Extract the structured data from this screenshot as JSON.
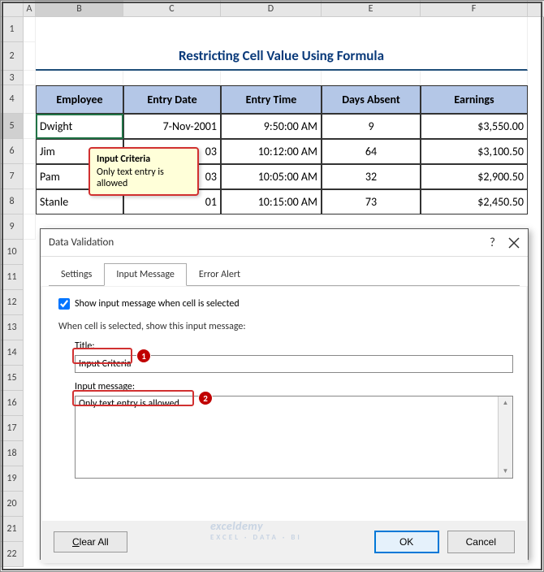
{
  "columns": [
    "A",
    "B",
    "C",
    "D",
    "E",
    "F"
  ],
  "title": "Restricting Cell Value Using Formula",
  "headers": {
    "b": "Employee",
    "c": "Entry Date",
    "d": "Entry Time",
    "e": "Days Absent",
    "f": "Earnings"
  },
  "rows": [
    {
      "b": "Dwight",
      "c": "7-Nov-2001",
      "d": "9:50:00 AM",
      "e": "9",
      "f": "$3,550.00"
    },
    {
      "b": "Jim",
      "c": "03",
      "d": "10:12:00 AM",
      "e": "64",
      "f": "$3,100.50"
    },
    {
      "b": "Pam",
      "c": "03",
      "d": "10:05:00 AM",
      "e": "32",
      "f": "$2,900.50"
    },
    {
      "b": "Stanle",
      "c": "01",
      "d": "10:15:00 AM",
      "e": "73",
      "f": "$2,450.50"
    }
  ],
  "tooltip": {
    "title": "Input Criteria",
    "body": "Only text entry is allowed"
  },
  "dialog": {
    "title": "Data Validation",
    "help": "?",
    "tabs": {
      "settings": "Settings",
      "input": "Input Message",
      "error": "Error Alert"
    },
    "checkbox": "Show input message when cell is selected",
    "prompt": "When cell is selected, show this input message:",
    "title_lbl": "Title:",
    "title_val": "Input Criteria",
    "msg_lbl": "Input message:",
    "msg_val": "Only text entry is allowed",
    "clear": "Clear All",
    "ok": "OK",
    "cancel": "Cancel"
  },
  "callouts": {
    "one": "1",
    "two": "2"
  },
  "watermark": {
    "main": "exceldemy",
    "sub": "EXCEL · DATA · BI"
  }
}
